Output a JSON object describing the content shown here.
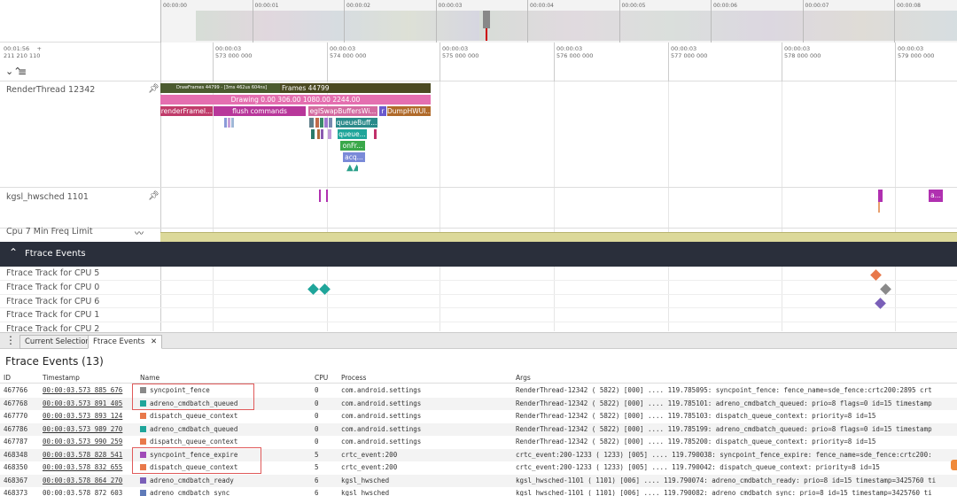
{
  "overview": {
    "ticks": [
      "00:00:00",
      "00:00:01",
      "00:00:02",
      "00:00:03",
      "00:00:04",
      "00:00:05",
      "00:00:06",
      "00:00:07",
      "00:00:08"
    ]
  },
  "timeaxis": {
    "origin_time": "00:01:56",
    "origin_sub": "211 210 110",
    "plus": "+",
    "ticks": [
      {
        "time": "00:00:03",
        "sub": "573 000 000"
      },
      {
        "time": "00:00:03",
        "sub": "574 000 000"
      },
      {
        "time": "00:00:03",
        "sub": "575 000 000"
      },
      {
        "time": "00:00:03",
        "sub": "576 000 000"
      },
      {
        "time": "00:00:03",
        "sub": "577 000 000"
      },
      {
        "time": "00:00:03",
        "sub": "578 000 000"
      },
      {
        "time": "00:00:03",
        "sub": "579 000 000"
      }
    ]
  },
  "tracks": {
    "renderthread": "RenderThread 12342",
    "kgsl": "kgsl_hwsched 1101",
    "cpu7": "Cpu 7 Min Freq Limit",
    "pin_icon": "pin-icon",
    "trend_icon": "trend-icon"
  },
  "slices": {
    "drawframes_small": "DrawFrames 44799 - [3ms 462us 604ns]",
    "drawframes": "Frames 44799",
    "drawing": "Drawing  0.00 306.00 1080.00 2244.00",
    "renderframe": "renderFrameI...",
    "flush": "flush commands",
    "eglswap": "eglSwapBuffersWi...",
    "r": "r",
    "dumphwui": "DumpHWUI...",
    "queuebuff": "queueBuff...",
    "queue": "queue...",
    "onfr": "onFr...",
    "acq": "acq...",
    "kgsl_a": "a..."
  },
  "ftrace": {
    "group_title": "Ftrace Events",
    "collapse_icon": "chevron-up-icon",
    "tracks": [
      "Ftrace Track for CPU 5",
      "Ftrace Track for CPU 0",
      "Ftrace Track for CPU 6",
      "Ftrace Track for CPU 1",
      "Ftrace Track for CPU 2"
    ]
  },
  "tabs": {
    "menu_icon": "kebab-menu-icon",
    "current_selection": "Current Selection",
    "ftrace_events": "Ftrace Events",
    "close": "✕"
  },
  "panel": {
    "title": "Ftrace Events (13)",
    "columns": [
      "ID",
      "Timestamp",
      "Name",
      "CPU",
      "Process",
      "Args"
    ],
    "rows": [
      {
        "id": "467766",
        "ts": "00:00:03.573 885 676",
        "name": "syncpoint_fence",
        "color": "#8a8a8a",
        "cpu": "0",
        "process": "com.android.settings",
        "args": "RenderThread-12342 ( 5822) [000] .... 119.785095: syncpoint_fence: fence_name=sde_fence:crtc200:2895 crt"
      },
      {
        "id": "467768",
        "ts": "00:00:03.573 891 405",
        "name": "adreno_cmdbatch_queued",
        "color": "#1fa59a",
        "cpu": "0",
        "process": "com.android.settings",
        "args": "RenderThread-12342 ( 5822) [000] .... 119.785101: adreno_cmdbatch_queued: prio=8 flags=0 id=15 timestamp"
      },
      {
        "id": "467770",
        "ts": "00:00:03.573 893 124",
        "name": "dispatch_queue_context",
        "color": "#e8784a",
        "cpu": "0",
        "process": "com.android.settings",
        "args": "RenderThread-12342 ( 5822) [000] .... 119.785103: dispatch_queue_context: priority=8 id=15"
      },
      {
        "id": "467786",
        "ts": "00:00:03.573 989 270",
        "name": "adreno_cmdbatch_queued",
        "color": "#1fa59a",
        "cpu": "0",
        "process": "com.android.settings",
        "args": "RenderThread-12342 ( 5822) [000] .... 119.785199: adreno_cmdbatch_queued: prio=8 flags=0 id=15 timestamp"
      },
      {
        "id": "467787",
        "ts": "00:00:03.573 990 259",
        "name": "dispatch_queue_context",
        "color": "#e8784a",
        "cpu": "0",
        "process": "com.android.settings",
        "args": "RenderThread-12342 ( 5822) [000] .... 119.785200: dispatch_queue_context: priority=8 id=15"
      },
      {
        "id": "468348",
        "ts": "00:00:03.578 828 541",
        "name": "syncpoint_fence_expire",
        "color": "#a04ab8",
        "cpu": "5",
        "process": "crtc_event:200",
        "args": "crtc_event:200-1233 ( 1233) [005] .... 119.790038: syncpoint_fence_expire: fence_name=sde_fence:crtc200:"
      },
      {
        "id": "468350",
        "ts": "00:00:03.578 832 655",
        "name": "dispatch_queue_context",
        "color": "#e8784a",
        "cpu": "5",
        "process": "crtc_event:200",
        "args": "crtc_event:200-1233 ( 1233) [005] .... 119.790042: dispatch_queue_context: priority=8 id=15"
      },
      {
        "id": "468367",
        "ts": "00:00:03.578 864 270",
        "name": "adreno_cmdbatch_ready",
        "color": "#7a5fb8",
        "cpu": "6",
        "process": "kgsl_hwsched",
        "args": "kgsl_hwsched-1101 ( 1101) [006] .... 119.790074: adreno_cmdbatch_ready: prio=8 id=15 timestamp=3425760 ti"
      },
      {
        "id": "468373",
        "ts": "00:00:03.578 872 603",
        "name": "adreno_cmdbatch_sync",
        "color": "#5f7ab8",
        "cpu": "6",
        "process": "kgsl_hwsched",
        "args": "kgsl_hwsched-1101 ( 1101) [006] .... 119.790082: adreno_cmdbatch_sync: prio=8 id=15 timestamp=3425760 ti"
      }
    ]
  }
}
